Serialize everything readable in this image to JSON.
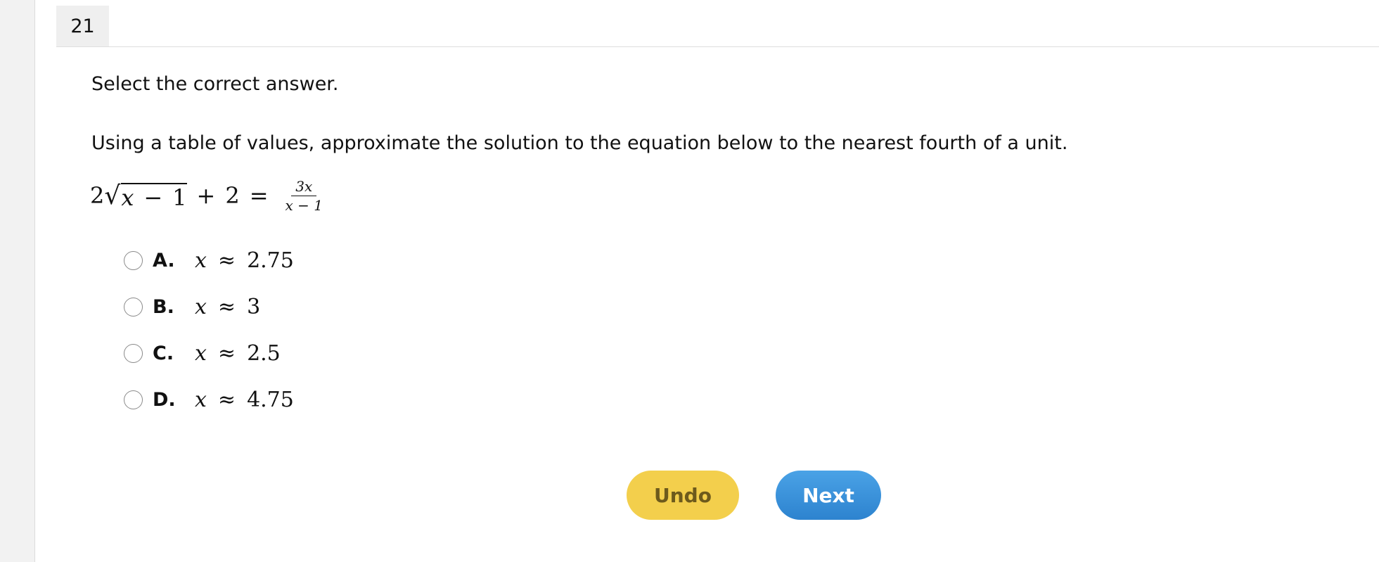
{
  "question": {
    "number": "21",
    "instruction": "Select the correct answer.",
    "prompt": "Using a table of values, approximate the solution to the equation below to the nearest fourth of a unit.",
    "equation": {
      "coef": "2",
      "radicand_var": "x",
      "minus": "−",
      "radicand_const": "1",
      "plus": "+",
      "addend": "2",
      "equals": "=",
      "frac_num": "3x",
      "frac_den": "x − 1"
    }
  },
  "choices": [
    {
      "letter": "A.",
      "variable": "x",
      "approx": "≈",
      "value": "2.75"
    },
    {
      "letter": "B.",
      "variable": "x",
      "approx": "≈",
      "value": "3"
    },
    {
      "letter": "C.",
      "variable": "x",
      "approx": "≈",
      "value": "2.5"
    },
    {
      "letter": "D.",
      "variable": "x",
      "approx": "≈",
      "value": "4.75"
    }
  ],
  "buttons": {
    "undo": "Undo",
    "next": "Next"
  },
  "colors": {
    "undo_bg": "#f3cf4c",
    "next_bg": "#3b93dc"
  }
}
